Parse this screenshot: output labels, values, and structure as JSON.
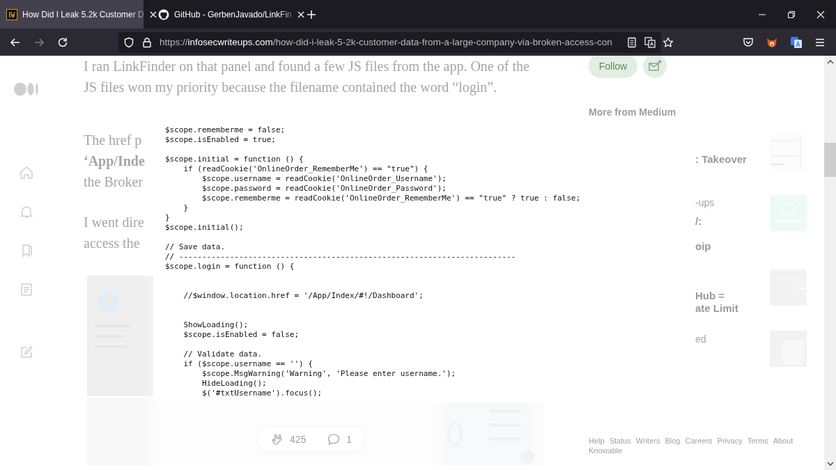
{
  "browser": {
    "tabs": [
      {
        "title": "How Did I Leak 5.2k Customer D",
        "selected": true
      },
      {
        "title": "GitHub - GerbenJavado/LinkFin",
        "selected": false
      }
    ],
    "nav_buttons": [
      {
        "kind": "back",
        "disabled": false
      },
      {
        "kind": "forward",
        "disabled": true
      },
      {
        "kind": "reload",
        "disabled": false
      }
    ],
    "address": {
      "scheme": "https://",
      "host": "infosecwriteups.com",
      "path": "/how-did-i-leak-5-2k-customer-data-from-a-large-company-via-broken-access-con"
    }
  },
  "article": {
    "paragraph": "I ran LinkFinder on that panel and found a few JS files from the app. One of the JS files won my priority because the filename contained the word “login”.",
    "fragments": [
      {
        "lines": [
          {
            "text": "The href p",
            "bold": false
          },
          {
            "text": "‘App/Inde",
            "bold": true
          },
          {
            "text": "the Broker",
            "bold": false
          }
        ]
      },
      {
        "lines": [
          {
            "text": "I went dire",
            "bold": false
          },
          {
            "text": "access the",
            "bold": false
          }
        ]
      }
    ],
    "claps": "425",
    "responses": "1"
  },
  "code_image": {
    "code": "$scope.rememberme = false;\n$scope.isEnabled = true;\n\n$scope.initial = function () {\n    if (readCookie('OnlineOrder_RememberMe') == \"true\") {\n        $scope.username = readCookie('OnlineOrder_Username');\n        $scope.password = readCookie('OnlineOrder_Password');\n        $scope.rememberme = readCookie('OnlineOrder_RememberMe') == \"true\" ? true : false;\n    }\n}\n$scope.initial();\n\n// Save data.\n// -------------------------------------------------------------------------\n$scope.login = function () {\n\n\n    //$window.location.href = '/App/Index/#!/Dashboard';\n\n\n    ShowLoading();\n    $scope.isEnabled = false;\n\n    // Validate data.\n    if ($scope.username == '') {\n        $scope.MsgWarning('Warning', 'Please enter username.');\n        HideLoading();\n        $('#txtUsername').focus();"
  },
  "sidebar": {
    "follow": "Follow",
    "heading": "More from Medium",
    "stories": [
      {
        "lines": [
          {
            "text": ": Takeover",
            "bold": true
          }
        ]
      },
      {
        "lines": [
          {
            "text": "-ups",
            "bold": false
          },
          {
            "text": "/:",
            "bold": true
          },
          {
            "text": "oip",
            "bold": true
          }
        ]
      },
      {
        "lines": [
          {
            "text": "Hub =",
            "bold": true
          },
          {
            "text": "ate Limit",
            "bold": true
          }
        ]
      },
      {
        "lines": [
          {
            "text": "ed",
            "bold": false
          }
        ]
      }
    ],
    "footer_links": [
      "Help",
      "Status",
      "Writers",
      "Blog",
      "Careers",
      "Privacy",
      "Terms",
      "About",
      "Knowable"
    ]
  }
}
